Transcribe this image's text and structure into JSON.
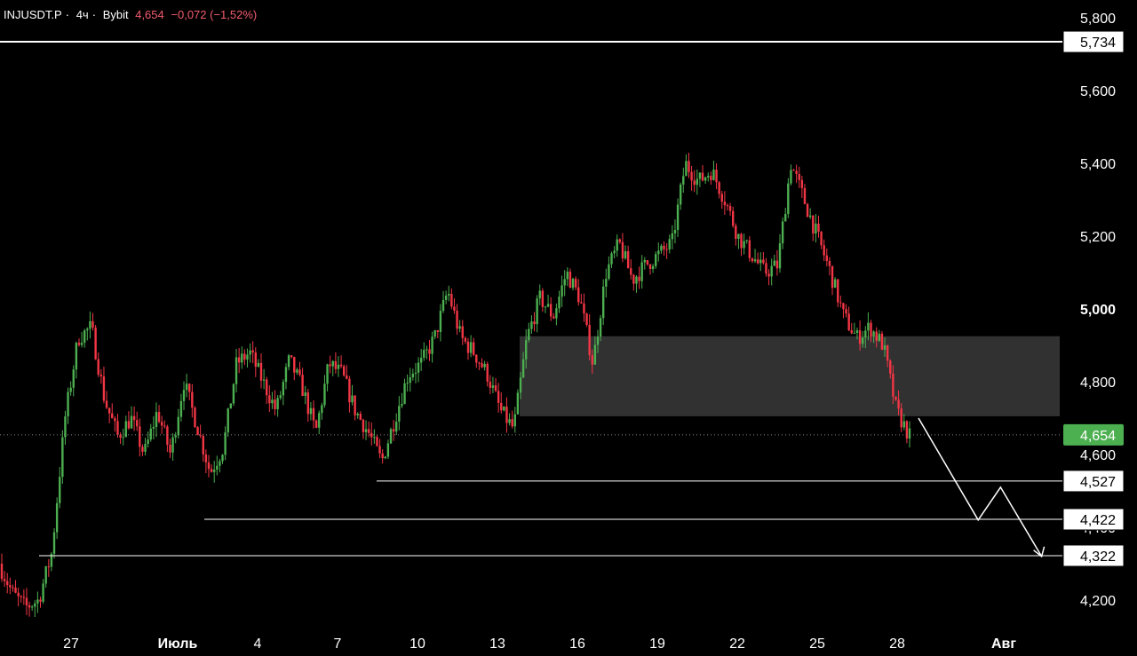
{
  "header": {
    "symbol": "INJUSDT.P",
    "timeframe": "4ч",
    "exchange": "Bybit",
    "last_price": "4,654",
    "change": "−0,072 (−1,52%)"
  },
  "colors": {
    "background": "#000000",
    "up": "#4caf50",
    "down": "#f23645",
    "zone": "#3a3a3a",
    "lines": "#ffffff"
  },
  "chart_data": {
    "type": "candlestick",
    "y_range": [
      4.14,
      5.84
    ],
    "y_ticks": [
      "5,800",
      "5,600",
      "5,400",
      "5,200",
      "5,000",
      "4,800",
      "4,600",
      "4,400",
      "4,200"
    ],
    "y_tick_values": [
      5.8,
      5.6,
      5.4,
      5.2,
      5.0,
      4.8,
      4.6,
      4.4,
      4.2
    ],
    "x_range_days": [
      25.25,
      34.5
    ],
    "x_ticks": [
      {
        "label": "27",
        "day": 26
      },
      {
        "label": "Июль",
        "day": 27
      },
      {
        "label": "4",
        "day": 28
      },
      {
        "label": "7",
        "day": 29
      },
      {
        "label": "10",
        "day": 30
      },
      {
        "label": "13",
        "day": 31
      },
      {
        "label": "16",
        "day": 32
      },
      {
        "label": "19",
        "day": 33
      },
      {
        "label": "22",
        "day": 34
      },
      {
        "label": "25",
        "day": 35
      },
      {
        "label": "28",
        "day": 36
      },
      {
        "label": "Авг",
        "day": 37
      }
    ],
    "x_tick_pos": [
      80,
      200,
      290,
      380,
      470,
      560,
      650,
      740,
      830,
      920,
      1010,
      1130
    ],
    "price_path": [
      [
        0,
        4.3
      ],
      [
        0.5,
        4.22
      ],
      [
        1,
        4.18
      ],
      [
        1.5,
        4.2
      ],
      [
        2,
        4.33
      ],
      [
        2.5,
        4.7
      ],
      [
        3,
        4.92
      ],
      [
        3.5,
        4.95
      ],
      [
        4,
        4.75
      ],
      [
        4.5,
        4.65
      ],
      [
        5,
        4.7
      ],
      [
        5.5,
        4.6
      ],
      [
        6,
        4.72
      ],
      [
        6.5,
        4.6
      ],
      [
        7,
        4.8
      ],
      [
        7.5,
        4.68
      ],
      [
        8,
        4.55
      ],
      [
        8.5,
        4.62
      ],
      [
        9,
        4.85
      ],
      [
        9.5,
        4.88
      ],
      [
        10,
        4.8
      ],
      [
        10.5,
        4.72
      ],
      [
        11,
        4.86
      ],
      [
        11.5,
        4.78
      ],
      [
        12,
        4.66
      ],
      [
        12.5,
        4.85
      ],
      [
        13,
        4.82
      ],
      [
        13.5,
        4.72
      ],
      [
        14,
        4.66
      ],
      [
        14.5,
        4.58
      ],
      [
        15,
        4.7
      ],
      [
        15.5,
        4.82
      ],
      [
        16,
        4.85
      ],
      [
        16.5,
        4.92
      ],
      [
        17,
        5.05
      ],
      [
        17.5,
        4.92
      ],
      [
        18,
        4.88
      ],
      [
        18.5,
        4.82
      ],
      [
        19,
        4.72
      ],
      [
        19.5,
        4.67
      ],
      [
        20,
        4.92
      ],
      [
        20.5,
        5.03
      ],
      [
        21,
        4.98
      ],
      [
        21.5,
        5.1
      ],
      [
        22,
        5.03
      ],
      [
        22.5,
        4.85
      ],
      [
        23,
        5.1
      ],
      [
        23.5,
        5.18
      ],
      [
        24,
        5.08
      ],
      [
        24.5,
        5.12
      ],
      [
        25,
        5.15
      ],
      [
        25.5,
        5.18
      ],
      [
        26,
        5.4
      ],
      [
        26.5,
        5.35
      ],
      [
        27,
        5.38
      ],
      [
        27.5,
        5.3
      ],
      [
        28,
        5.2
      ],
      [
        28.5,
        5.15
      ],
      [
        29,
        5.1
      ],
      [
        29.5,
        5.12
      ],
      [
        30,
        5.4
      ],
      [
        30.5,
        5.3
      ],
      [
        31,
        5.2
      ],
      [
        31.5,
        5.1
      ],
      [
        32,
        4.98
      ],
      [
        32.5,
        4.92
      ],
      [
        33,
        4.95
      ],
      [
        33.5,
        4.9
      ],
      [
        34,
        4.72
      ],
      [
        34.5,
        4.65
      ]
    ],
    "levels": [
      {
        "label": "5,734",
        "value": 5.734
      },
      {
        "label": "4,527",
        "value": 4.527
      },
      {
        "label": "4,422",
        "value": 4.422
      },
      {
        "label": "4,322",
        "value": 4.322
      }
    ],
    "current_price": {
      "label": "4,654",
      "value": 4.654
    },
    "zone": {
      "from": 4.705,
      "to": 4.925
    },
    "projection": [
      {
        "day": 0,
        "value": 4.7
      },
      {
        "day": 1.6,
        "value": 4.42
      },
      {
        "day": 2.2,
        "value": 4.51
      },
      {
        "day": 3.3,
        "value": 4.32
      }
    ]
  }
}
